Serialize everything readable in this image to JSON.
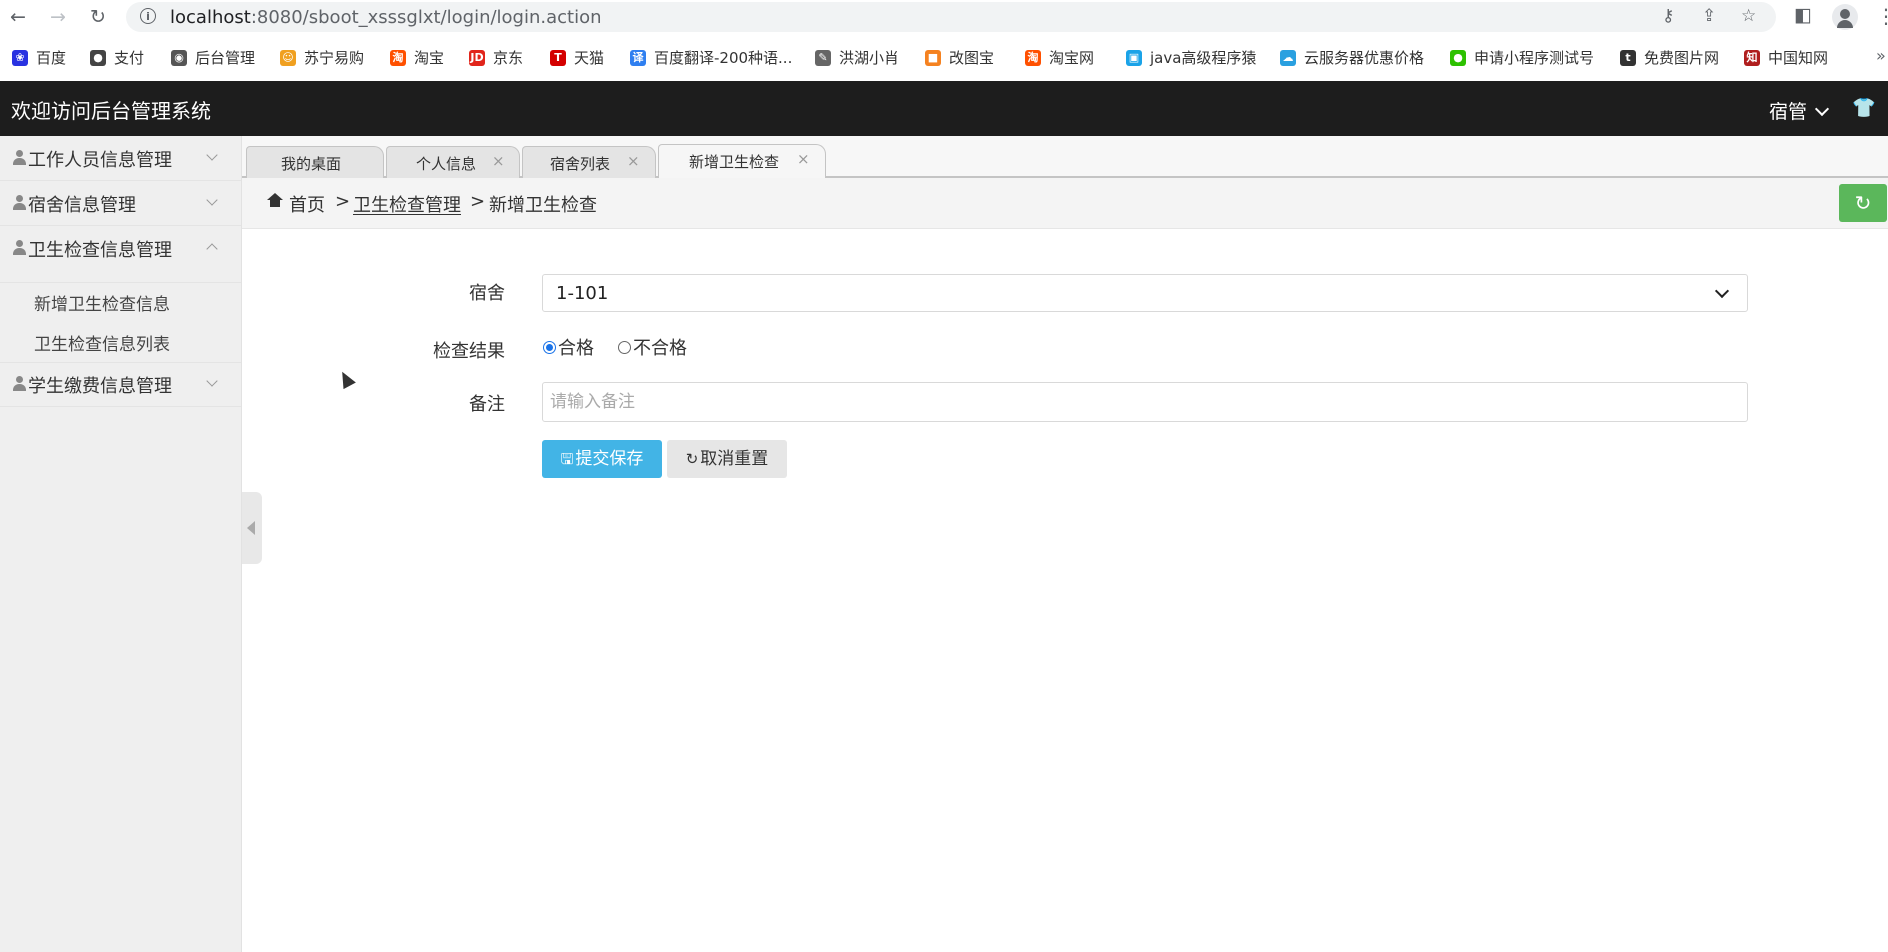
{
  "browser": {
    "url_host": "localhost",
    "url_rest": ":8080/sboot_xsssglxt/login/login.action",
    "bookmarks": [
      {
        "label": "百度",
        "color": "#2932e1",
        "glyph": "❀"
      },
      {
        "label": "支付",
        "color": "#444444",
        "glyph": "●"
      },
      {
        "label": "后台管理",
        "color": "#555555",
        "glyph": "◉"
      },
      {
        "label": "苏宁易购",
        "color": "#f0a020",
        "glyph": "☺"
      },
      {
        "label": "淘宝",
        "color": "#ff5000",
        "glyph": "淘"
      },
      {
        "label": "京东",
        "color": "#e1251b",
        "glyph": "JD"
      },
      {
        "label": "天猫",
        "color": "#d40000",
        "glyph": "T"
      },
      {
        "label": "百度翻译-200种语...",
        "color": "#2f7ff0",
        "glyph": "译"
      },
      {
        "label": "洪湖小肖",
        "color": "#666666",
        "glyph": "✎"
      },
      {
        "label": "改图宝",
        "color": "#f58220",
        "glyph": "■"
      },
      {
        "label": "淘宝网",
        "color": "#ff5000",
        "glyph": "淘"
      },
      {
        "label": "java高级程序猿",
        "color": "#1aa3e8",
        "glyph": "▣"
      },
      {
        "label": "云服务器优惠价格",
        "color": "#2aa0e0",
        "glyph": "☁"
      },
      {
        "label": "申请小程序测试号",
        "color": "#2dc100",
        "glyph": "●"
      },
      {
        "label": "免费图片网",
        "color": "#333333",
        "glyph": "t"
      },
      {
        "label": "中国知网",
        "color": "#b01e1e",
        "glyph": "知"
      }
    ]
  },
  "header": {
    "title": "欢迎访问后台管理系统",
    "user_label": "宿管"
  },
  "sidebar": {
    "items": [
      {
        "label": "工作人员信息管理"
      },
      {
        "label": "宿舍信息管理"
      },
      {
        "label": "卫生检查信息管理"
      },
      {
        "label": "学生缴费信息管理"
      }
    ],
    "submenu": [
      {
        "label": "新增卫生检查信息"
      },
      {
        "label": "卫生检查信息列表"
      }
    ]
  },
  "tabs": [
    {
      "label": "我的桌面"
    },
    {
      "label": "个人信息"
    },
    {
      "label": "宿舍列表"
    },
    {
      "label": "新增卫生检查"
    }
  ],
  "breadcrumb": {
    "home": "首页",
    "sep": ">",
    "section": "卫生检查管理",
    "current": "新增卫生检查"
  },
  "form": {
    "dorm_label": "宿舍",
    "dorm_value": "1-101",
    "result_label": "检查结果",
    "result_options": [
      "合格",
      "不合格"
    ],
    "result_selected": "合格",
    "note_label": "备注",
    "note_placeholder": "请输入备注",
    "save_label": "提交保存",
    "reset_label": "取消重置"
  },
  "colors": {
    "header_bg": "#1d1d1d",
    "save_button": "#42b4e6",
    "refresh_button": "#5bb75b"
  },
  "icons": [
    "back-icon",
    "forward-icon",
    "reload-icon",
    "info-icon",
    "key-icon",
    "share-icon",
    "star-icon",
    "sidepanel-icon",
    "profile-icon",
    "home-icon",
    "refresh-icon",
    "save-icon",
    "reset-icon",
    "shirt-icon"
  ]
}
